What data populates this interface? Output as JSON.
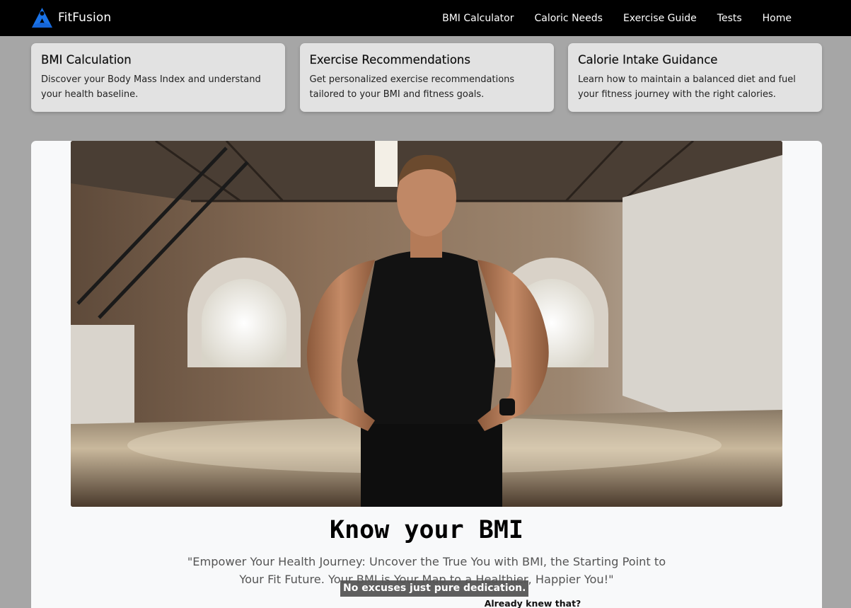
{
  "navbar": {
    "brand": "FitFusion",
    "brand_icon": "fitfusion-logo-icon",
    "brand_color": "#1a73e8",
    "links": [
      "BMI Calculator",
      "Caloric Needs",
      "Exercise Guide",
      "Tests",
      "Home"
    ]
  },
  "cards": [
    {
      "title": "BMI Calculation",
      "text": "Discover your Body Mass Index and understand your health baseline."
    },
    {
      "title": "Exercise Recommendations",
      "text": "Get personalized exercise recommendations tailored to your BMI and fitness goals."
    },
    {
      "title": "Calorie Intake Guidance",
      "text": "Learn how to maintain a balanced diet and fuel your fitness journey with the right calories."
    }
  ],
  "hero": {
    "video_caption": "No excuses just pure dedication.",
    "title": "Know your BMI",
    "quote": "\"Empower Your Health Journey: Uncover the True You with BMI, the Starting Point to Your Fit Future. Your BMI is Your Map to a Healthier, Happier You!\"",
    "already_text": "Already knew that?"
  }
}
